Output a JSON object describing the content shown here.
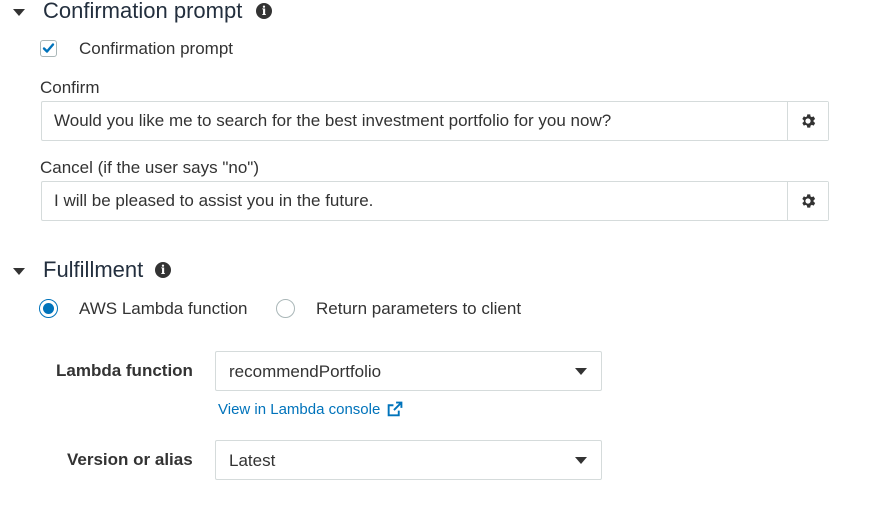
{
  "confirmation_section": {
    "title": "Confirmation prompt",
    "checkbox_label": "Confirmation prompt",
    "checkbox_checked": true,
    "confirm_label": "Confirm",
    "confirm_value": "Would you like me to search for the best investment portfolio for you now?",
    "cancel_label": "Cancel (if the user says \"no\")",
    "cancel_value": "I will be pleased to assist you in the future."
  },
  "fulfillment_section": {
    "title": "Fulfillment",
    "radio_options": [
      {
        "label": "AWS Lambda function",
        "selected": true
      },
      {
        "label": "Return parameters to client",
        "selected": false
      }
    ],
    "lambda_function_label": "Lambda function",
    "lambda_function_value": "recommendPortfolio",
    "lambda_console_link": "View in Lambda console",
    "version_label": "Version or alias",
    "version_value": "Latest"
  },
  "icons": {
    "section_toggle": "caret-down-icon",
    "info": "info-icon",
    "settings": "gear-icon",
    "external_link": "external-link-icon",
    "dropdown": "chevron-down-icon"
  },
  "colors": {
    "accent": "#0073bb",
    "text": "#333333",
    "title": "#232f3e",
    "border": "#d5dbdb"
  }
}
